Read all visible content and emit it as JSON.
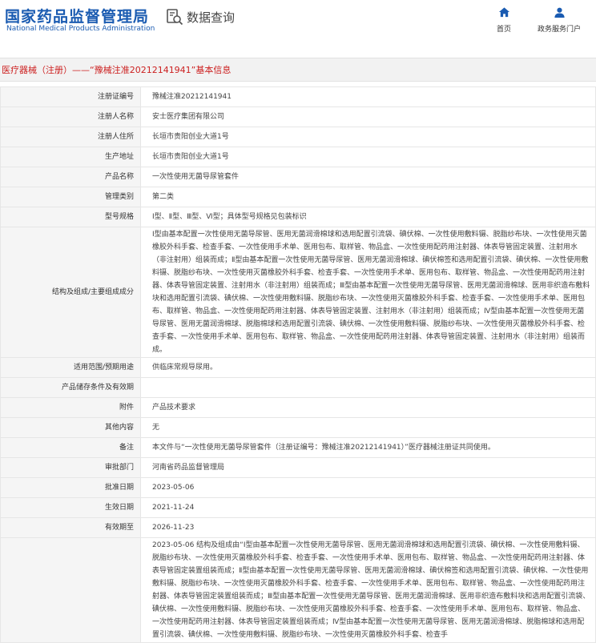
{
  "header": {
    "logo_cn": "国家药品监督管理局",
    "logo_en": "National Medical Products Administration",
    "search_label": "数据查询",
    "nav": [
      {
        "label": "首页",
        "icon": "home-icon"
      },
      {
        "label": "政务服务门户",
        "icon": "user-icon"
      }
    ],
    "brand_color": "#1a5bb1"
  },
  "title": "医疗器械（注册）——“豫械注准20212141941”基本信息",
  "title_color": "#cc1f1f",
  "fields": [
    {
      "label": "注册证编号",
      "value": "豫械注准20212141941"
    },
    {
      "label": "注册人名称",
      "value": "安士医疗集团有限公司"
    },
    {
      "label": "注册人住所",
      "value": "长垣市贵阳创业大道1号"
    },
    {
      "label": "生产地址",
      "value": "长垣市贵阳创业大道1号"
    },
    {
      "label": "产品名称",
      "value": "一次性使用无菌导尿管套件"
    },
    {
      "label": "管理类别",
      "value": "第二类"
    },
    {
      "label": "型号规格",
      "value": "Ⅰ型、Ⅱ型、Ⅲ型、Ⅵ型；具体型号规格见包装标识"
    },
    {
      "label": "结构及组成/主要组成成分",
      "value": "Ⅰ型由基本配置一次性使用无菌导尿管、医用无菌润滑棉球和选用配置引流袋、碘伏棉、一次性使用敷料镊、脱脂纱布块、一次性使用灭菌橡胶外科手套、检查手套、一次性使用手术单、医用包布、取样管、物品盒、一次性使用配药用注射器、体表导管固定装置、注射用水（非注射用）组装而成；Ⅱ型由基本配置一次性使用无菌导尿管、医用无菌润滑棉球、碘伏棉签和选用配置引流袋、碘伏棉、一次性使用敷料镊、脱脂纱布块、一次性使用灭菌橡胶外科手套、检查手套、一次性使用手术单、医用包布、取样管、物品盒、一次性使用配药用注射器、体表导管固定装置、注射用水（非注射用）组装而成；Ⅲ型由基本配置一次性使用无菌导尿管、医用无菌润滑棉球、医用非织造布敷料块和选用配置引流袋、碘伏棉、一次性使用敷料镊、脱脂纱布块、一次性使用灭菌橡胶外科手套、检查手套、一次性使用手术单、医用包布、取样管、物品盒、一次性使用配药用注射器、体表导管固定装置、注射用水（非注射用）组装而成；Ⅳ型由基本配置一次性使用无菌导尿管、医用无菌润滑棉球、脱脂棉球和选用配置引流袋、碘伏棉、一次性使用敷料镊、脱脂纱布块、一次性使用灭菌橡胶外科手套、检查手套、一次性使用手术单、医用包布、取样管、物品盒、一次性使用配药用注射器、体表导管固定装置、注射用水（非注射用）组装而成。"
    },
    {
      "label": "适用范围/预期用途",
      "value": "供临床常规导尿用。"
    },
    {
      "label": "产品储存条件及有效期",
      "value": ""
    },
    {
      "label": "附件",
      "value": "产品技术要求"
    },
    {
      "label": "其他内容",
      "value": "无"
    },
    {
      "label": "备注",
      "value": "本文件与“一次性使用无菌导尿管套件（注册证编号：豫械注准20212141941）”医疗器械注册证共同使用。"
    },
    {
      "label": "审批部门",
      "value": "河南省药品监督管理局"
    },
    {
      "label": "批准日期",
      "value": "2023-05-06"
    },
    {
      "label": "生效日期",
      "value": "2021-11-24"
    },
    {
      "label": "有效期至",
      "value": "2026-11-23"
    },
    {
      "label": "",
      "value": "2023-05-06 结构及组成由“Ⅰ型由基本配置一次性使用无菌导尿管、医用无菌润滑棉球和选用配置引流袋、碘伏棉、一次性使用敷料镊、脱脂纱布块、一次性使用灭菌橡胶外科手套、检查手套、一次性使用手术单、医用包布、取样管、物品盒、一次性使用配药用注射器、体表导管固定装置组装而成；Ⅱ型由基本配置一次性使用无菌导尿管、医用无菌润滑棉球、碘伏棉签和选用配置引流袋、碘伏棉、一次性使用敷料镊、脱脂纱布块、一次性使用灭菌橡胶外科手套、检查手套、一次性使用手术单、医用包布、取样管、物品盒、一次性使用配药用注射器、体表导管固定装置组装而成；Ⅲ型由基本配置一次性使用无菌导尿管、医用无菌润滑棉球、医用非织造布敷料块和选用配置引流袋、碘伏棉、一次性使用敷料镊、脱脂纱布块、一次性使用灭菌橡胶外科手套、检查手套、一次性使用手术单、医用包布、取样管、物品盒、一次性使用配药用注射器、体表导管固定装置组装而成；Ⅳ型由基本配置一次性使用无菌导尿管、医用无菌润滑棉球、脱脂棉球和选用配置引流袋、碘伏棉、一次性使用敷料镊、脱脂纱布块、一次性使用灭菌橡胶外科手套、检查手"
    }
  ]
}
